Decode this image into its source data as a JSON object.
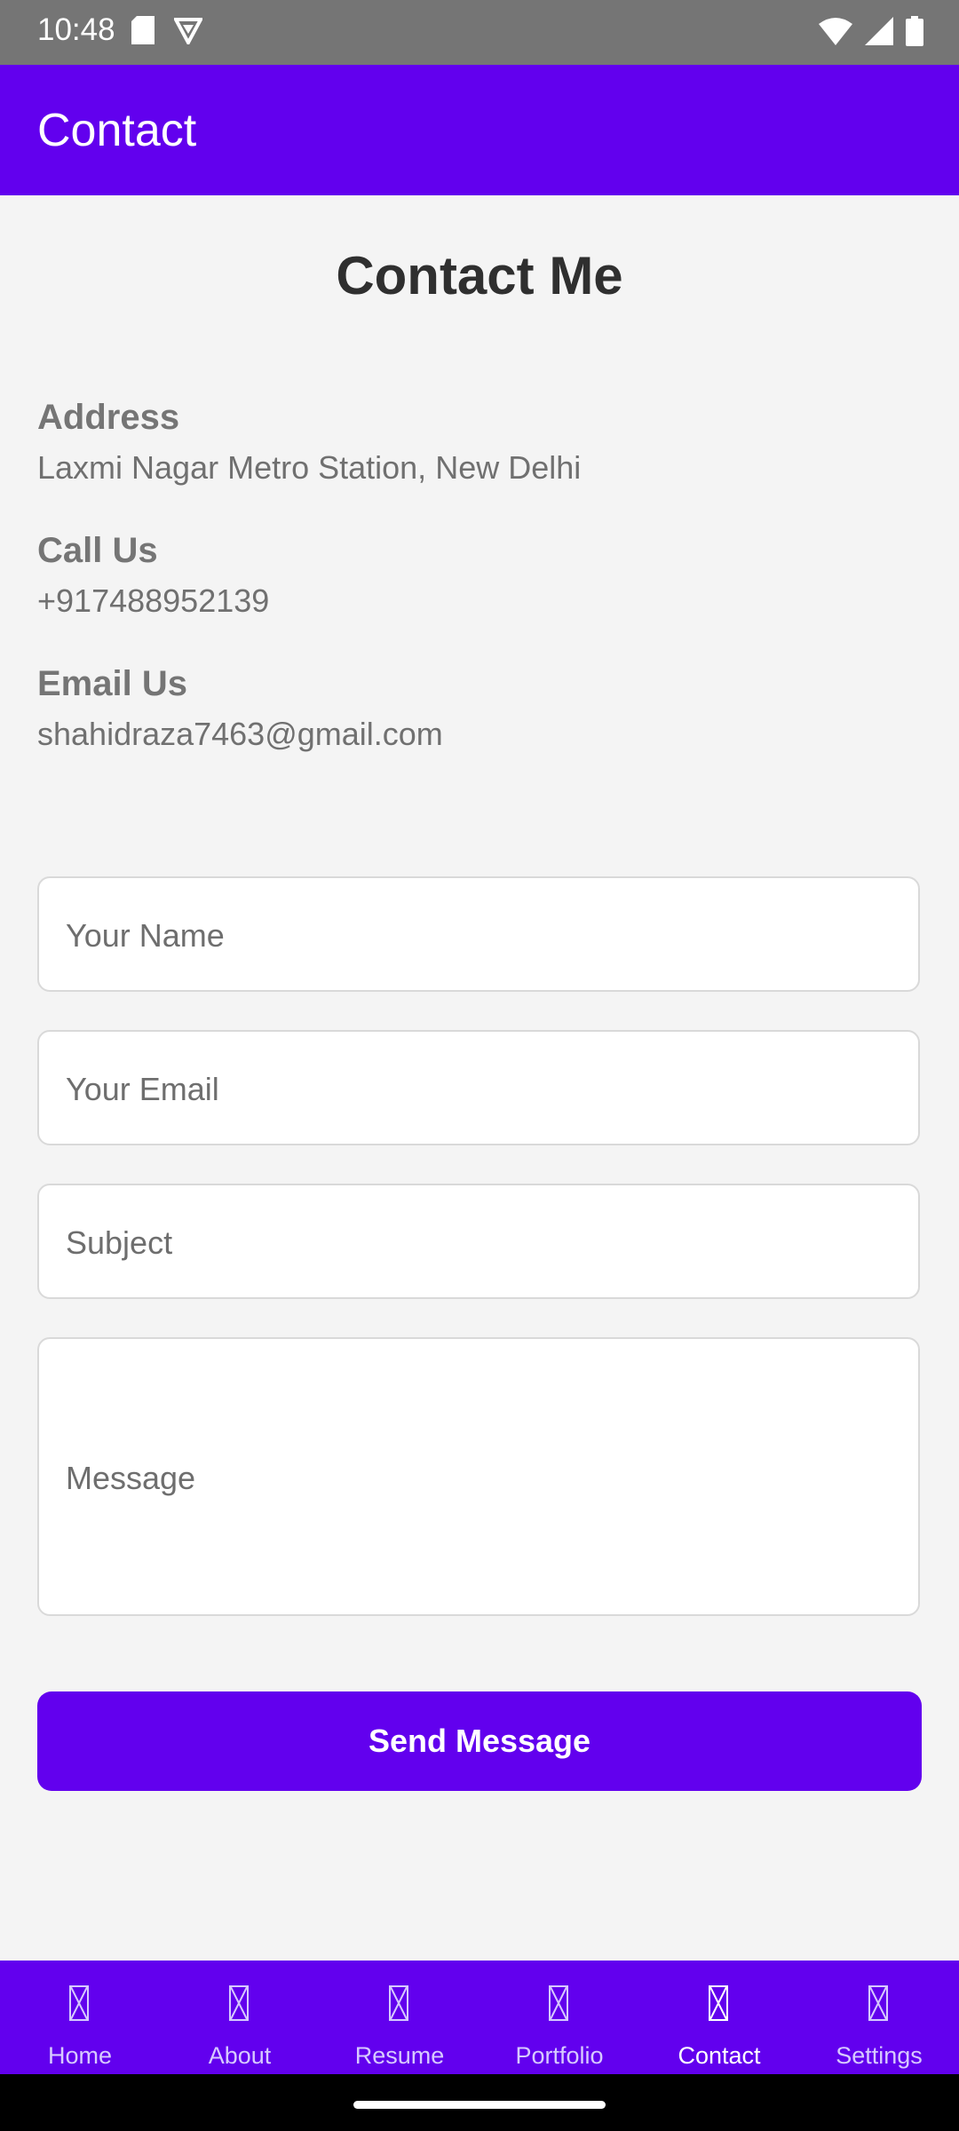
{
  "status_bar": {
    "time": "10:48",
    "icons": [
      "sd-card-icon",
      "vpn-shield-icon",
      "wifi-icon",
      "signal-icon",
      "battery-icon"
    ]
  },
  "app_bar": {
    "title": "Contact"
  },
  "page": {
    "title": "Contact Me"
  },
  "contact_info": [
    {
      "label": "Address",
      "value": "Laxmi Nagar Metro Station, New Delhi"
    },
    {
      "label": "Call Us",
      "value": "+917488952139"
    },
    {
      "label": "Email Us",
      "value": "shahidraza7463@gmail.com"
    }
  ],
  "form": {
    "name_placeholder": "Your Name",
    "email_placeholder": "Your Email",
    "subject_placeholder": "Subject",
    "message_placeholder": "Message",
    "submit_label": "Send Message"
  },
  "bottom_nav": {
    "items": [
      {
        "label": "Home",
        "active": false
      },
      {
        "label": "About",
        "active": false
      },
      {
        "label": "Resume",
        "active": false
      },
      {
        "label": "Portfolio",
        "active": false
      },
      {
        "label": "Contact",
        "active": true
      },
      {
        "label": "Settings",
        "active": false
      }
    ]
  },
  "colors": {
    "primary": "#6200ee",
    "status_bar": "#757575",
    "background": "#f4f4f4"
  }
}
